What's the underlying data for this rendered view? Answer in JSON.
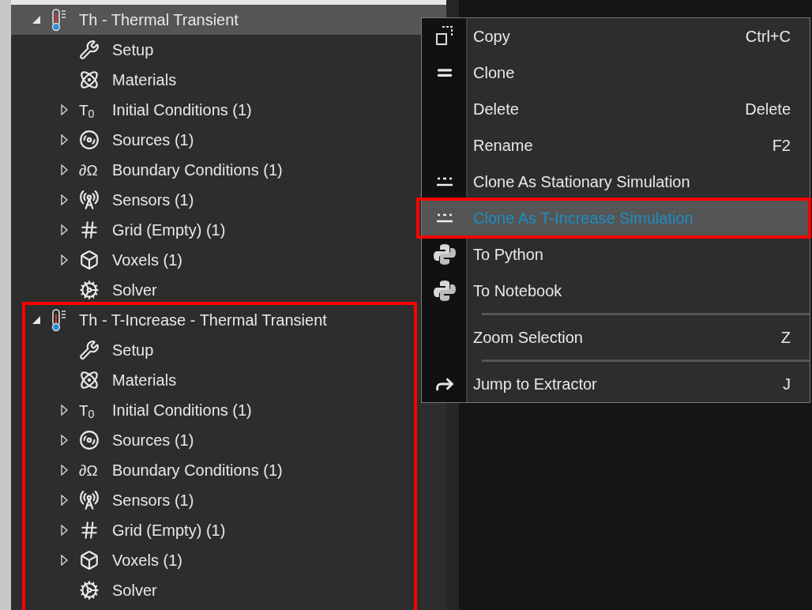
{
  "tree": [
    {
      "title": "Th - Thermal Transient",
      "expanded": true,
      "selected": true,
      "annotated": false,
      "children": [
        {
          "kind": "setup",
          "label": "Setup",
          "expandable": false
        },
        {
          "kind": "materials",
          "label": "Materials",
          "expandable": false
        },
        {
          "kind": "glyph",
          "glyph": "T$_{0}$",
          "label": "Initial Conditions (1)",
          "expandable": true
        },
        {
          "kind": "sources",
          "label": "Sources (1)",
          "expandable": true
        },
        {
          "kind": "glyph",
          "glyph": "∂Ω",
          "label": "Boundary Conditions (1)",
          "expandable": true
        },
        {
          "kind": "sensors",
          "label": "Sensors (1)",
          "expandable": true
        },
        {
          "kind": "grid",
          "label": "Grid (Empty) (1)",
          "expandable": true
        },
        {
          "kind": "voxels",
          "label": "Voxels (1)",
          "expandable": true
        },
        {
          "kind": "solver",
          "label": "Solver",
          "expandable": false
        }
      ]
    },
    {
      "title": "Th - T-Increase - Thermal Transient",
      "expanded": true,
      "selected": false,
      "annotated": true,
      "children": [
        {
          "kind": "setup",
          "label": "Setup",
          "expandable": false
        },
        {
          "kind": "materials",
          "label": "Materials",
          "expandable": false
        },
        {
          "kind": "glyph",
          "glyph": "T$_{0}$",
          "label": "Initial Conditions (1)",
          "expandable": true
        },
        {
          "kind": "sources",
          "label": "Sources (1)",
          "expandable": true
        },
        {
          "kind": "glyph",
          "glyph": "∂Ω",
          "label": "Boundary Conditions (1)",
          "expandable": true
        },
        {
          "kind": "sensors",
          "label": "Sensors (1)",
          "expandable": true
        },
        {
          "kind": "grid",
          "label": "Grid (Empty) (1)",
          "expandable": true
        },
        {
          "kind": "voxels",
          "label": "Voxels (1)",
          "expandable": true
        },
        {
          "kind": "solver",
          "label": "Solver",
          "expandable": false
        }
      ]
    }
  ],
  "context_menu": [
    {
      "kind": "copy",
      "label": "Copy",
      "shortcut": "Ctrl+C",
      "selected": false,
      "annotated": false
    },
    {
      "kind": "clone",
      "label": "Clone",
      "selected": false,
      "annotated": false
    },
    {
      "kind": "plain",
      "label": "Delete",
      "shortcut": "Delete",
      "selected": false,
      "annotated": false
    },
    {
      "kind": "plain",
      "label": "Rename",
      "shortcut": "F2",
      "selected": false,
      "annotated": false
    },
    {
      "kind": "stationary",
      "label": "Clone As Stationary Simulation",
      "selected": false,
      "annotated": false
    },
    {
      "kind": "stationary",
      "label": "Clone As T-Increase Simulation",
      "selected": true,
      "annotated": true
    },
    {
      "kind": "python",
      "label": "To Python",
      "selected": false,
      "annotated": false
    },
    {
      "kind": "python",
      "label": "To Notebook",
      "selected": false,
      "annotated": false
    },
    {
      "kind": "separator"
    },
    {
      "kind": "plain",
      "label": "Zoom Selection",
      "shortcut": "Z",
      "selected": false,
      "annotated": false
    },
    {
      "kind": "separator"
    },
    {
      "kind": "extractor",
      "label": "Jump to Extractor",
      "shortcut": "J",
      "selected": false,
      "annotated": false
    }
  ]
}
